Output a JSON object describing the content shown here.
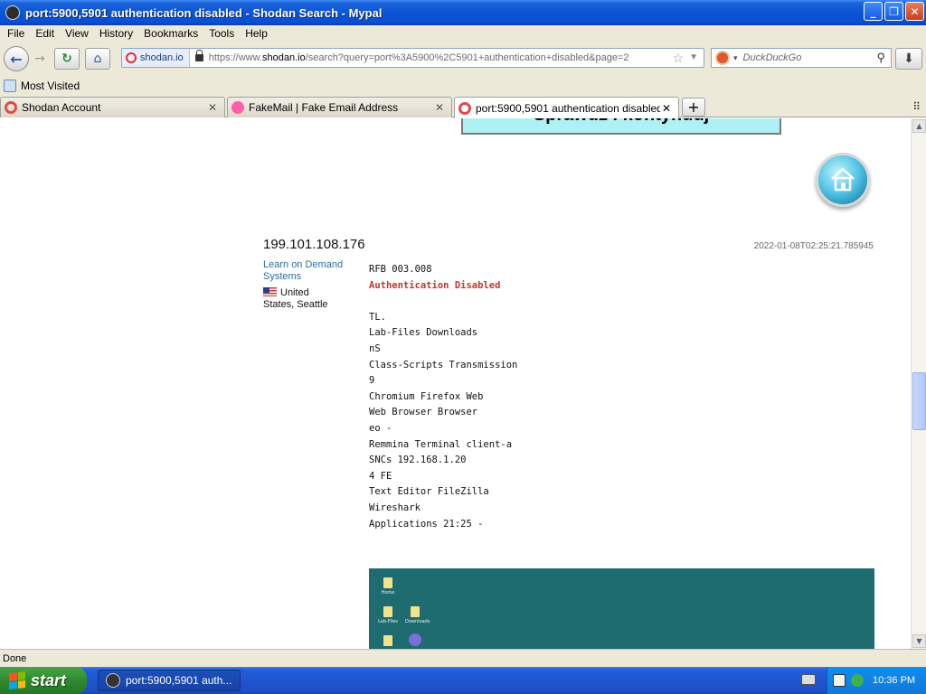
{
  "window": {
    "title": "port:5900,5901 authentication disabled - Shodan Search - Mypal",
    "buttons": {
      "minimize": "_",
      "maximize": "❐",
      "close": "✕"
    }
  },
  "menu": [
    "File",
    "Edit",
    "View",
    "History",
    "Bookmarks",
    "Tools",
    "Help"
  ],
  "nav": {
    "identity": "shodan.io",
    "url_prefix": "https://www.",
    "url_host": "shodan.io",
    "url_path": "/search?query=port%3A5900%2C5901+authentication+disabled&page=2",
    "search_placeholder": "DuckDuckGo"
  },
  "bookmarks": {
    "most_visited": "Most Visited"
  },
  "tabs": [
    {
      "label": "Shodan Account",
      "icon": "shodan-icon"
    },
    {
      "label": "FakeMail | Fake Email Address",
      "icon": "fakemail-icon"
    },
    {
      "label": "port:5900,5901 authentication disabled -...",
      "icon": "shodan-icon",
      "active": true
    }
  ],
  "page": {
    "ad_banner": "Sprawdź i kontynuuj",
    "result": {
      "ip": "199.101.108.176",
      "timestamp": "2022-01-08T02:25:21.785945",
      "org": "Learn on Demand Systems",
      "country": "United",
      "location_rest": "States, Seattle",
      "banner_lines": [
        "RFB 003.008",
        "Authentication Disabled",
        "",
        "TL.",
        "Lab-Files Downloads",
        "nS",
        "Class-Scripts Transmission",
        "9",
        "Chromium Firefox Web",
        "Web Browser Browser",
        "eo -",
        "Remmina Terminal client-a",
        "SNCs 192.168.1.20",
        "4 FE",
        "Text Editor FileZilla",
        "Wireshark",
        "Applications 21:25 -"
      ],
      "desktop_icons": [
        "Home",
        "Lab-Files",
        "Downloads"
      ]
    }
  },
  "status": {
    "text": "Done"
  },
  "taskbar": {
    "start": "start",
    "item": "port:5900,5901 auth...",
    "clock": "10:36 PM"
  }
}
